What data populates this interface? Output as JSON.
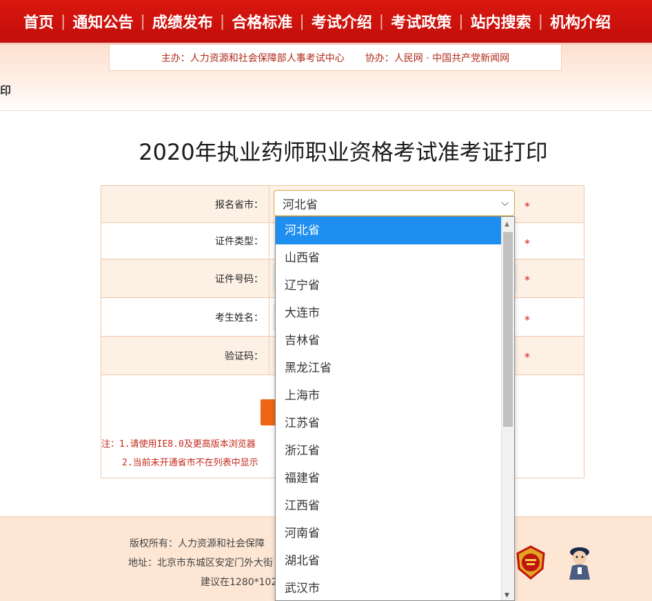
{
  "nav": {
    "items": [
      "首页",
      "通知公告",
      "成绩发布",
      "合格标准",
      "考试介绍",
      "考试政策",
      "站内搜索",
      "机构介绍"
    ]
  },
  "sponsor": {
    "host": "主办：人力资源和社会保障部人事考试中心",
    "cohost": "协办：人民网 · 中国共产党新闻网"
  },
  "breadcrumb": "印",
  "page": {
    "title": "2020年执业药师职业资格考试准考证打印"
  },
  "form": {
    "province_label": "报名省市：",
    "province_value": "河北省",
    "id_type_label": "证件类型：",
    "id_number_label": "证件号码：",
    "name_label": "考生姓名：",
    "captcha_label": "验证码：",
    "required_mark": "*"
  },
  "notes": {
    "line1": "注：1.请使用IE8.0及更高版本浏览器",
    "line2": "2.当前未开通省市不在列表中显示"
  },
  "footer": {
    "copyright": "版权所有：人力资源和社会保障",
    "address": "地址：北京市东城区安定门外大街",
    "advice": "建议在1280*102"
  },
  "dropdown": {
    "selected": "河北省",
    "options": [
      "河北省",
      "山西省",
      "辽宁省",
      "大连市",
      "吉林省",
      "黑龙江省",
      "上海市",
      "江苏省",
      "浙江省",
      "福建省",
      "江西省",
      "河南省",
      "湖北省",
      "武汉市"
    ]
  },
  "colors": {
    "nav_red": "#c20e0a",
    "highlight_blue": "#1e8ff0",
    "accent_orange": "#f06513",
    "required_red": "#d21a1a"
  }
}
